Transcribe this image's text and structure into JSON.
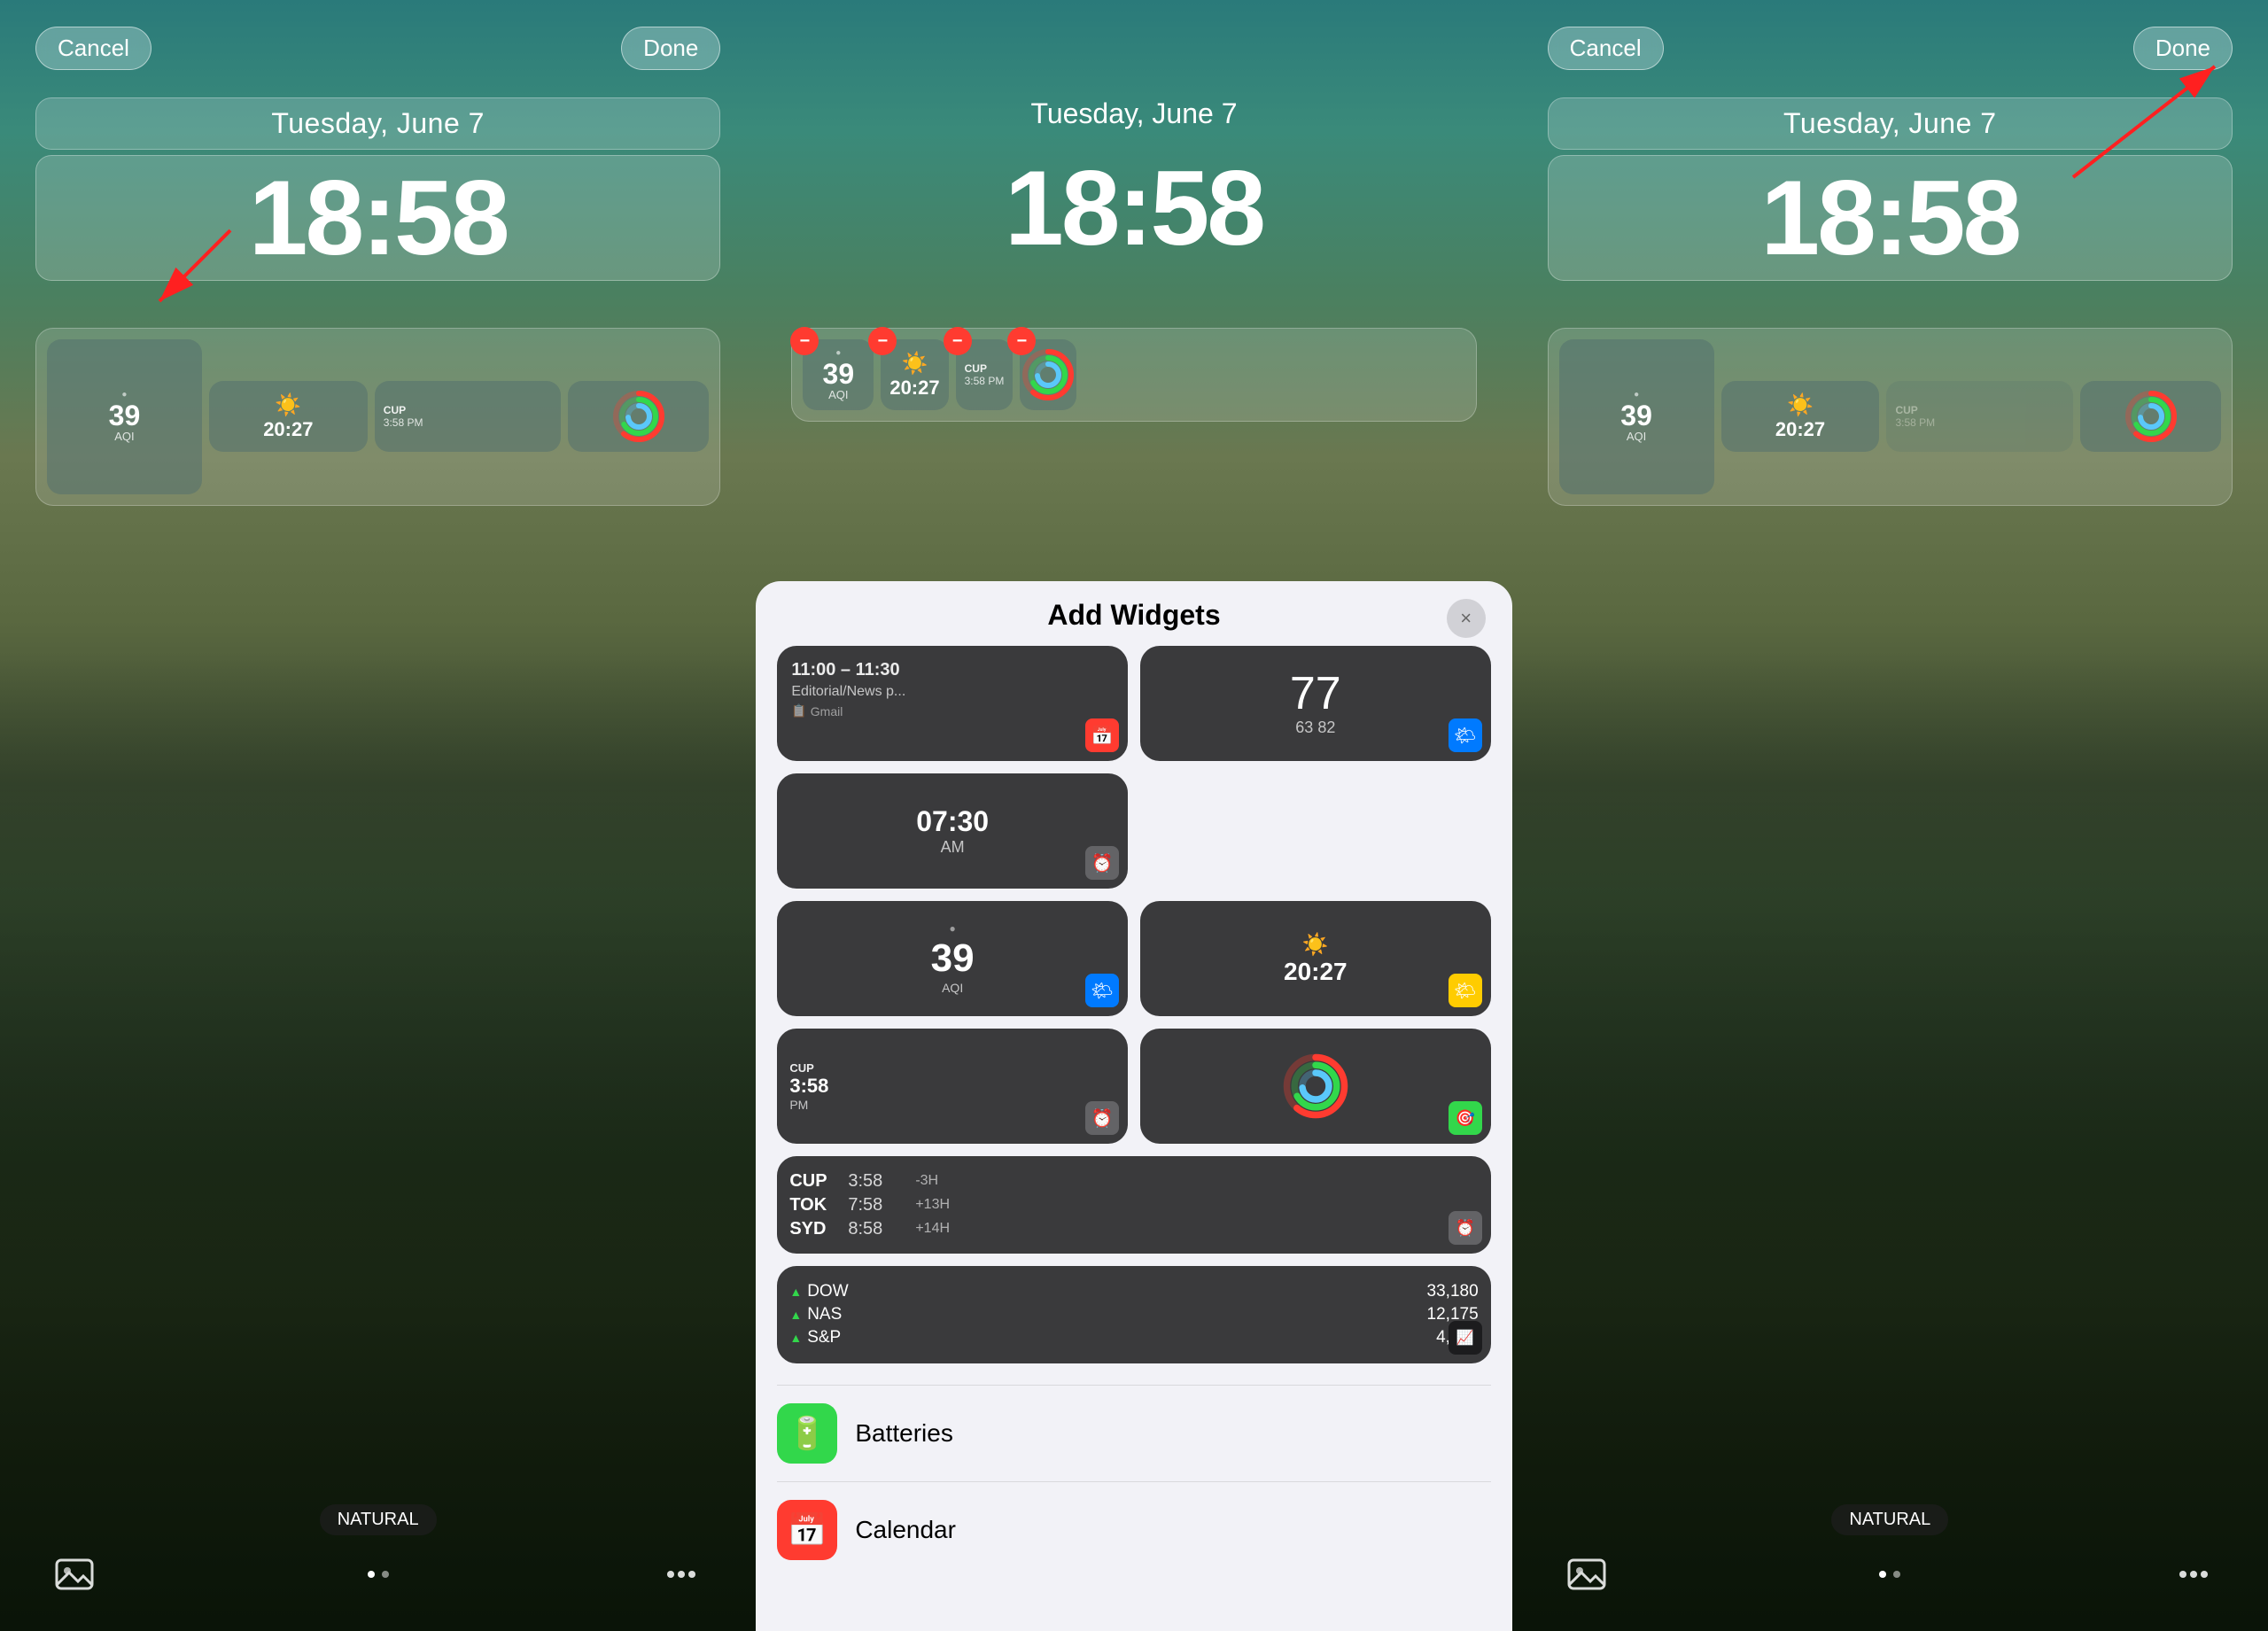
{
  "panels": {
    "left": {
      "cancel_label": "Cancel",
      "done_label": "Done",
      "date": "Tuesday, June 7",
      "time": "18:58",
      "widgets": {
        "aqi": {
          "value": "39",
          "label": "AQI"
        },
        "city_clock": {
          "city": "",
          "time": "20:27"
        },
        "cup_clock": {
          "city": "CUP",
          "time": "3:58",
          "ampm": "PM"
        },
        "rings": "activity rings"
      },
      "bottom_label": "NATURAL"
    },
    "middle": {
      "date": "Tuesday, June 7",
      "time": "18:58",
      "widgets": {
        "aqi": {
          "value": "39",
          "label": "AQI"
        },
        "city_clock": {
          "time": "20:27"
        },
        "cup_clock": {
          "city": "CUP",
          "time": "3:58",
          "ampm": "PM"
        },
        "rings": "activity rings"
      }
    },
    "right": {
      "cancel_label": "Cancel",
      "done_label": "Done",
      "date": "Tuesday, June 7",
      "time": "18:58",
      "widgets": {
        "aqi": {
          "value": "39",
          "label": "AQI"
        },
        "city_clock": {
          "time": "20:27"
        },
        "cup_clock": {
          "city": "CUP",
          "time": "3:58",
          "ampm": "PM"
        },
        "rings": "activity rings"
      },
      "bottom_label": "NATURAL"
    }
  },
  "modal": {
    "title": "Add Widgets",
    "close_label": "×",
    "widgets": [
      {
        "type": "calendar",
        "time": "11:00 – 11:30",
        "event": "Editorial/News p...",
        "app": "Gmail",
        "badge_color": "#ff3b30"
      },
      {
        "type": "weather",
        "temp": "77",
        "range": "63  82",
        "badge_color": "#007aff"
      },
      {
        "type": "clock",
        "time": "07:30",
        "ampm": "AM",
        "badge_color": "#636366"
      },
      {
        "type": "aqi",
        "value": "39",
        "label": "AQI",
        "badge_color": "#007aff"
      },
      {
        "type": "city_clock",
        "time": "20:27",
        "badge_color": "#ffcc00"
      },
      {
        "type": "cup_clock",
        "city": "CUP",
        "time": "3:58",
        "ampm": "PM",
        "badge_color": "#636366"
      },
      {
        "type": "rings",
        "badge_color": "#32d74b"
      }
    ],
    "tz_widget": {
      "rows": [
        {
          "city": "CUP",
          "time": "3:58",
          "offset": "-3H"
        },
        {
          "city": "TOK",
          "time": "7:58",
          "offset": "+13H"
        },
        {
          "city": "SYD",
          "time": "8:58",
          "offset": "+14H"
        }
      ]
    },
    "stocks_widget": {
      "rows": [
        {
          "name": "DOW",
          "price": "33,180"
        },
        {
          "name": "NAS",
          "price": "12,175"
        },
        {
          "name": "S&P",
          "price": "4,161"
        }
      ]
    },
    "list": [
      {
        "name": "Batteries",
        "icon": "🟢",
        "bg": "#32d74b"
      },
      {
        "name": "Calendar",
        "icon": "📅",
        "bg": "#ff3b30"
      }
    ]
  }
}
